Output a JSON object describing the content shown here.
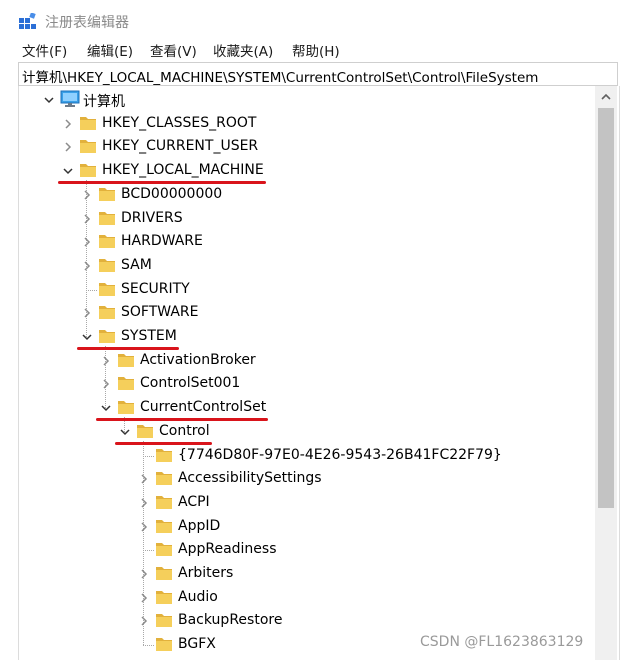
{
  "window": {
    "title": "注册表编辑器"
  },
  "menu": [
    "文件(F)",
    "编辑(E)",
    "查看(V)",
    "收藏夹(A)",
    "帮助(H)"
  ],
  "address": {
    "path": "计算机\\HKEY_LOCAL_MACHINE\\SYSTEM\\CurrentControlSet\\Control\\FileSystem"
  },
  "tree": [
    {
      "label": "计算机",
      "level": 0,
      "state": "expanded",
      "icon": "computer-icon"
    },
    {
      "label": "HKEY_CLASSES_ROOT",
      "level": 1,
      "state": "collapsed",
      "icon": "folder-icon"
    },
    {
      "label": "HKEY_CURRENT_USER",
      "level": 1,
      "state": "collapsed",
      "icon": "folder-icon"
    },
    {
      "label": "HKEY_LOCAL_MACHINE",
      "level": 1,
      "state": "expanded",
      "icon": "folder-icon",
      "highlighted": true
    },
    {
      "label": "BCD00000000",
      "level": 2,
      "state": "collapsed",
      "icon": "folder-icon"
    },
    {
      "label": "DRIVERS",
      "level": 2,
      "state": "collapsed",
      "icon": "folder-icon"
    },
    {
      "label": "HARDWARE",
      "level": 2,
      "state": "collapsed",
      "icon": "folder-icon"
    },
    {
      "label": "SAM",
      "level": 2,
      "state": "collapsed",
      "icon": "folder-icon"
    },
    {
      "label": "SECURITY",
      "level": 2,
      "state": "leaf",
      "icon": "folder-icon"
    },
    {
      "label": "SOFTWARE",
      "level": 2,
      "state": "collapsed",
      "icon": "folder-icon"
    },
    {
      "label": "SYSTEM",
      "level": 2,
      "state": "expanded",
      "icon": "folder-icon",
      "highlighted": true
    },
    {
      "label": "ActivationBroker",
      "level": 3,
      "state": "collapsed",
      "icon": "folder-icon"
    },
    {
      "label": "ControlSet001",
      "level": 3,
      "state": "collapsed",
      "icon": "folder-icon"
    },
    {
      "label": "CurrentControlSet",
      "level": 3,
      "state": "expanded",
      "icon": "folder-icon",
      "highlighted": true
    },
    {
      "label": "Control",
      "level": 4,
      "state": "expanded",
      "icon": "folder-icon",
      "highlighted": true
    },
    {
      "label": "{7746D80F-97E0-4E26-9543-26B41FC22F79}",
      "level": 5,
      "state": "leaf",
      "icon": "folder-icon"
    },
    {
      "label": "AccessibilitySettings",
      "level": 5,
      "state": "collapsed",
      "icon": "folder-icon"
    },
    {
      "label": "ACPI",
      "level": 5,
      "state": "collapsed",
      "icon": "folder-icon"
    },
    {
      "label": "AppID",
      "level": 5,
      "state": "collapsed",
      "icon": "folder-icon"
    },
    {
      "label": "AppReadiness",
      "level": 5,
      "state": "leaf",
      "icon": "folder-icon"
    },
    {
      "label": "Arbiters",
      "level": 5,
      "state": "collapsed",
      "icon": "folder-icon"
    },
    {
      "label": "Audio",
      "level": 5,
      "state": "collapsed",
      "icon": "folder-icon"
    },
    {
      "label": "BackupRestore",
      "level": 5,
      "state": "collapsed",
      "icon": "folder-icon"
    },
    {
      "label": "BGFX",
      "level": 5,
      "state": "leaf",
      "icon": "folder-icon"
    }
  ],
  "colors": {
    "folder": "#f5cf5b",
    "folder_dark": "#e2b13c",
    "highlight_underline": "#d9141b"
  },
  "watermark": "CSDN @FL1623863129"
}
